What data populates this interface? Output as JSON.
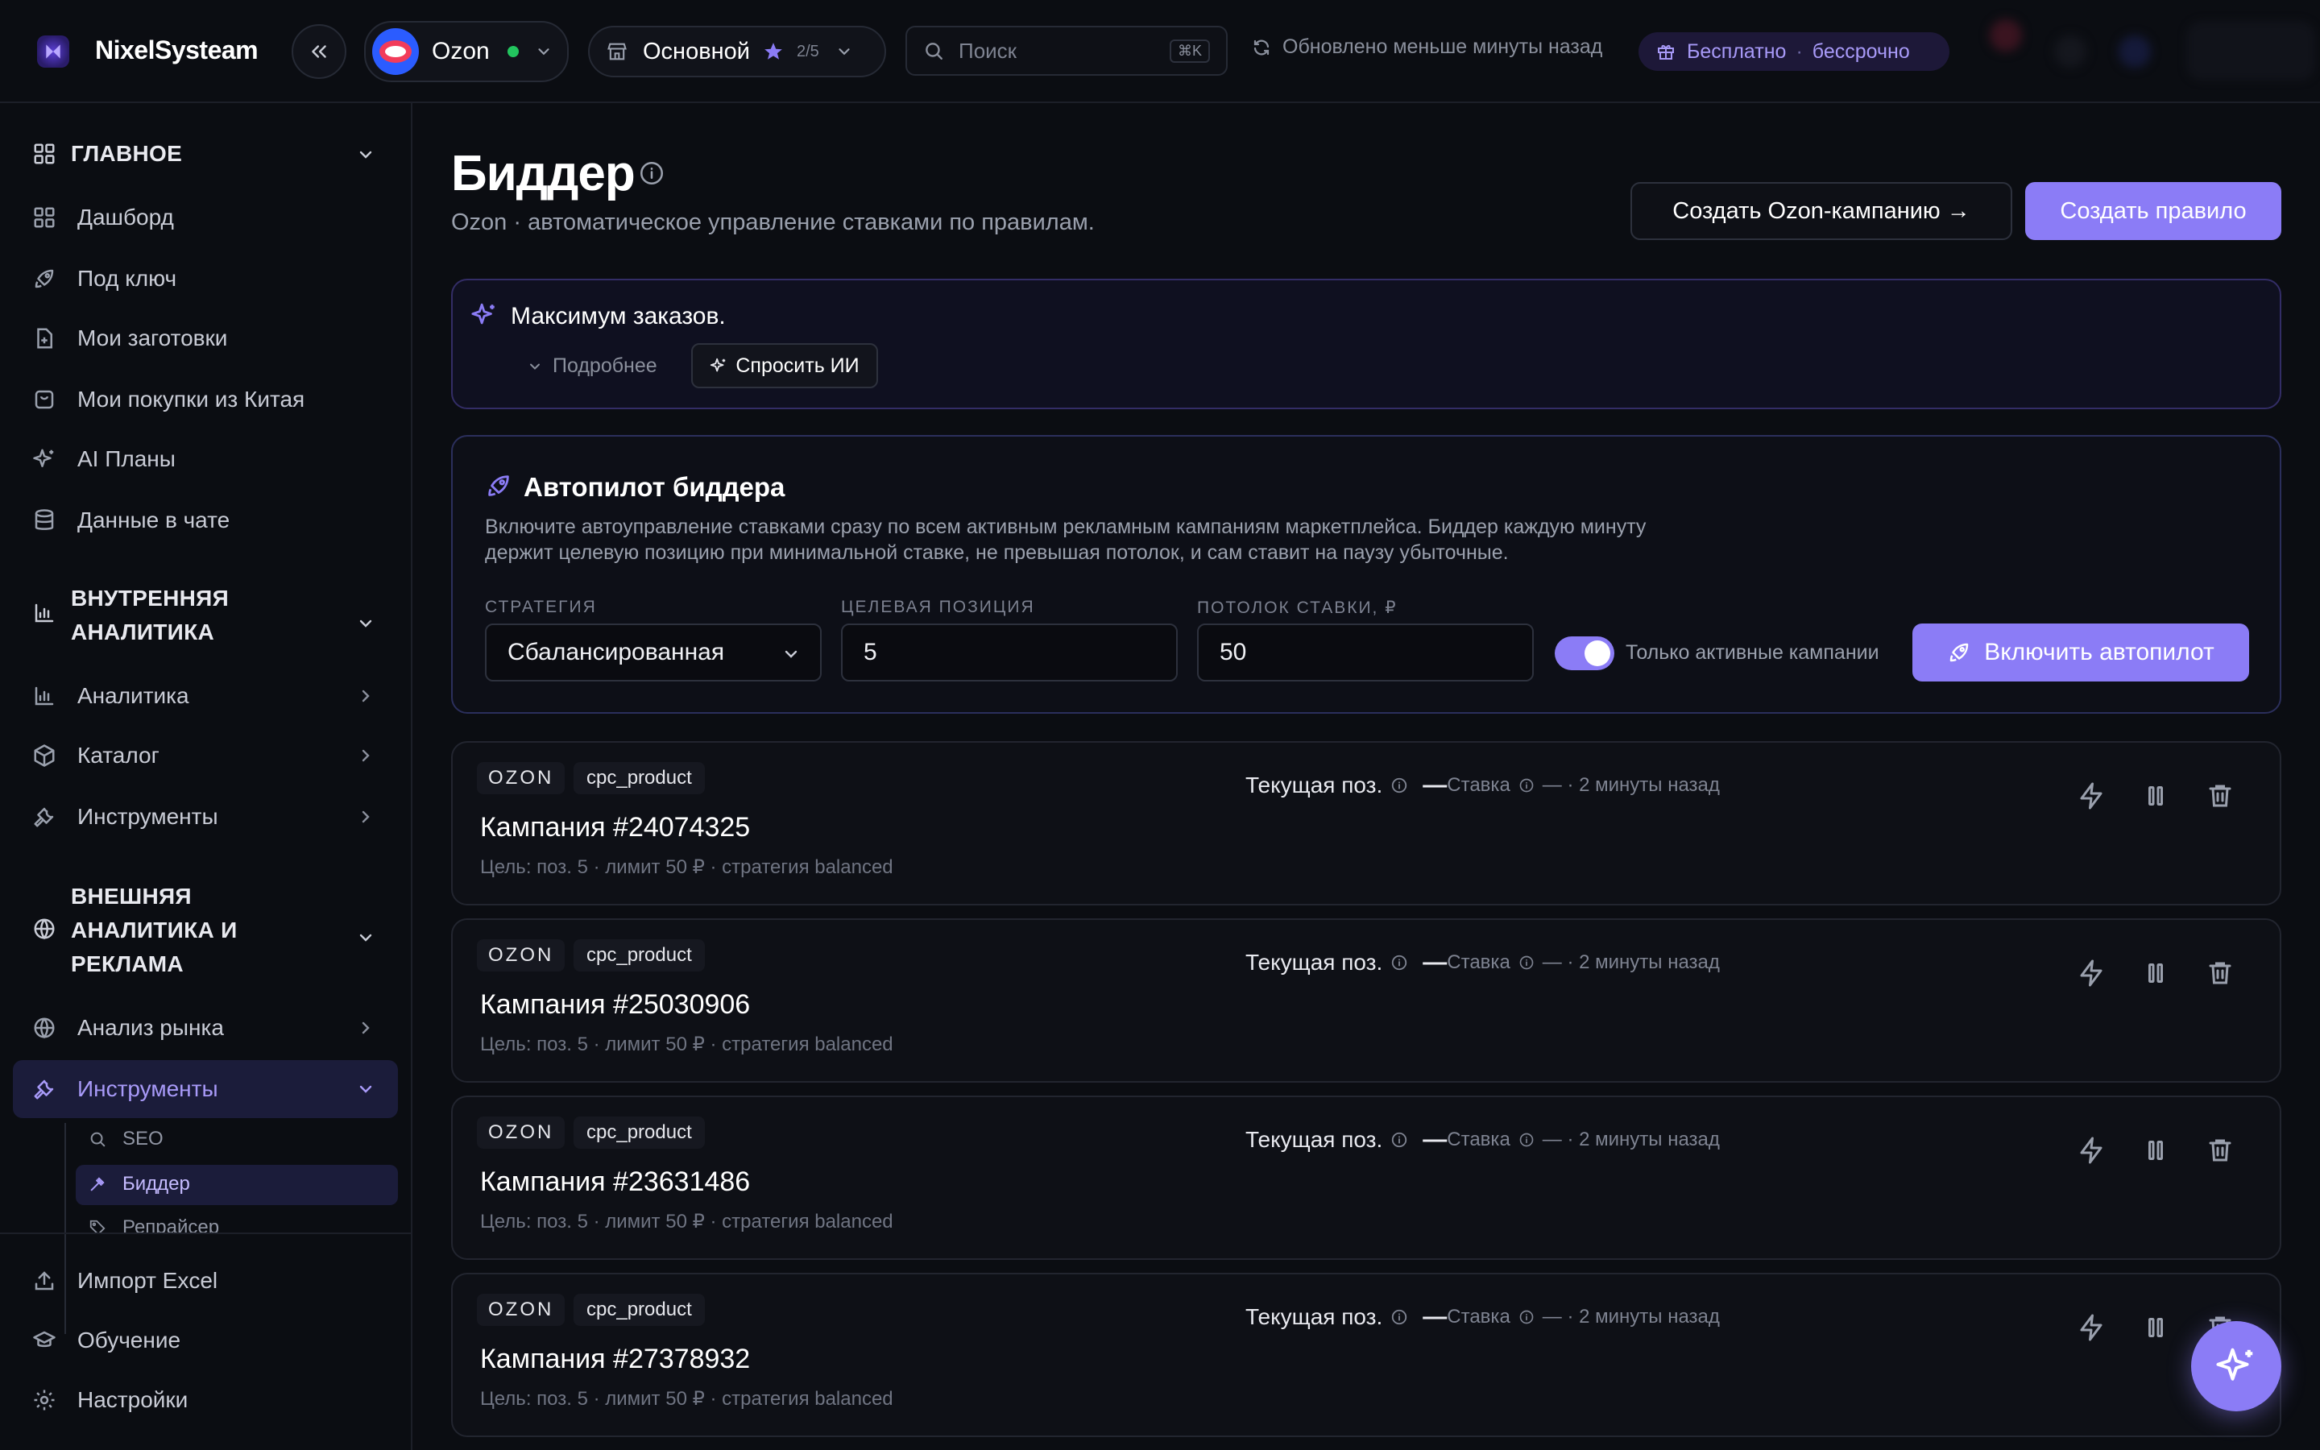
{
  "app": {
    "name": "NixelSysteam"
  },
  "topbar": {
    "marketplace": "Ozon",
    "workspace": "Основной",
    "workspace_count": "2/5",
    "search_placeholder": "Поиск",
    "search_shortcut": "⌘K",
    "updated": "Обновлено меньше минуты назад",
    "plan_label": "Бесплатно",
    "plan_sep": "·",
    "plan_term": "бессрочно"
  },
  "sidebar": {
    "main_section": "ГЛАВНОЕ",
    "main_items": [
      "Дашборд",
      "Под ключ",
      "Мои заготовки",
      "Мои покупки из Китая",
      "AI Планы",
      "Данные в чате"
    ],
    "internal_section_1": "ВНУТРЕННЯЯ",
    "internal_section_2": "АНАЛИТИКА",
    "internal_items": [
      "Аналитика",
      "Каталог",
      "Инструменты"
    ],
    "external_section_1": "ВНЕШНЯЯ",
    "external_section_2": "АНАЛИТИКА И",
    "external_section_3": "РЕКЛАМА",
    "external_items": [
      "Анализ рынка",
      "Инструменты"
    ],
    "sub_items": [
      "SEO",
      "Биддер",
      "Репрайсер"
    ],
    "bottom_items": [
      "Импорт Excel",
      "Обучение",
      "Настройки"
    ]
  },
  "page": {
    "title": "Биддер",
    "subtitle": "Ozon · автоматическое управление ставками по правилам.",
    "create_campaign": "Создать Ozon-кампанию →",
    "create_rule": "Создать правило"
  },
  "tip": {
    "text": "Максимум заказов.",
    "more": "Подробнее",
    "ask_ai": "Спросить ИИ"
  },
  "autopilot": {
    "title": "Автопилот биддера",
    "desc_1": "Включите автоуправление ставками сразу по всем активным рекламным кампаниям маркетплейса. Биддер каждую минуту",
    "desc_2": "держит целевую позицию при минимальной ставке, не превышая потолок, и сам ставит на паузу убыточные.",
    "strategy_label": "СТРАТЕГИЯ",
    "strategy_value": "Сбалансированная",
    "target_label": "ЦЕЛЕВАЯ ПОЗИЦИЯ",
    "target_value": "5",
    "ceiling_label": "ПОТОЛОК СТАВКИ, ₽",
    "ceiling_value": "50",
    "only_active": "Только активные кампании",
    "only_active_on": true,
    "enable": "Включить автопилот"
  },
  "campaigns": [
    {
      "platform": "OZON",
      "type": "cpc_product",
      "title": "Кампания #24074325",
      "goal": "Цель: поз. 5 · лимит 50 ₽ · стратегия balanced",
      "pos_label": "Текущая поз.",
      "pos_value": "—",
      "bid_label": "Ставка",
      "bid_tail": "— · 2 минуты назад"
    },
    {
      "platform": "OZON",
      "type": "cpc_product",
      "title": "Кампания #25030906",
      "goal": "Цель: поз. 5 · лимит 50 ₽ · стратегия balanced",
      "pos_label": "Текущая поз.",
      "pos_value": "—",
      "bid_label": "Ставка",
      "bid_tail": "— · 2 минуты назад"
    },
    {
      "platform": "OZON",
      "type": "cpc_product",
      "title": "Кампания #23631486",
      "goal": "Цель: поз. 5 · лимит 50 ₽ · стратегия balanced",
      "pos_label": "Текущая поз.",
      "pos_value": "—",
      "bid_label": "Ставка",
      "bid_tail": "— · 2 минуты назад"
    },
    {
      "platform": "OZON",
      "type": "cpc_product",
      "title": "Кампания #27378932",
      "goal": "Цель: поз. 5 · лимит 50 ₽ · стратегия balanced",
      "pos_label": "Текущая поз.",
      "pos_value": "—",
      "bid_label": "Ставка",
      "bid_tail": "— · 2 минуты назад"
    }
  ],
  "colors": {
    "accent": "#8b7cf6",
    "bg": "#0b0d12",
    "status_green": "#22c55e",
    "ozon_red": "#f23c5a",
    "ozon_blue": "#2b5cff"
  }
}
